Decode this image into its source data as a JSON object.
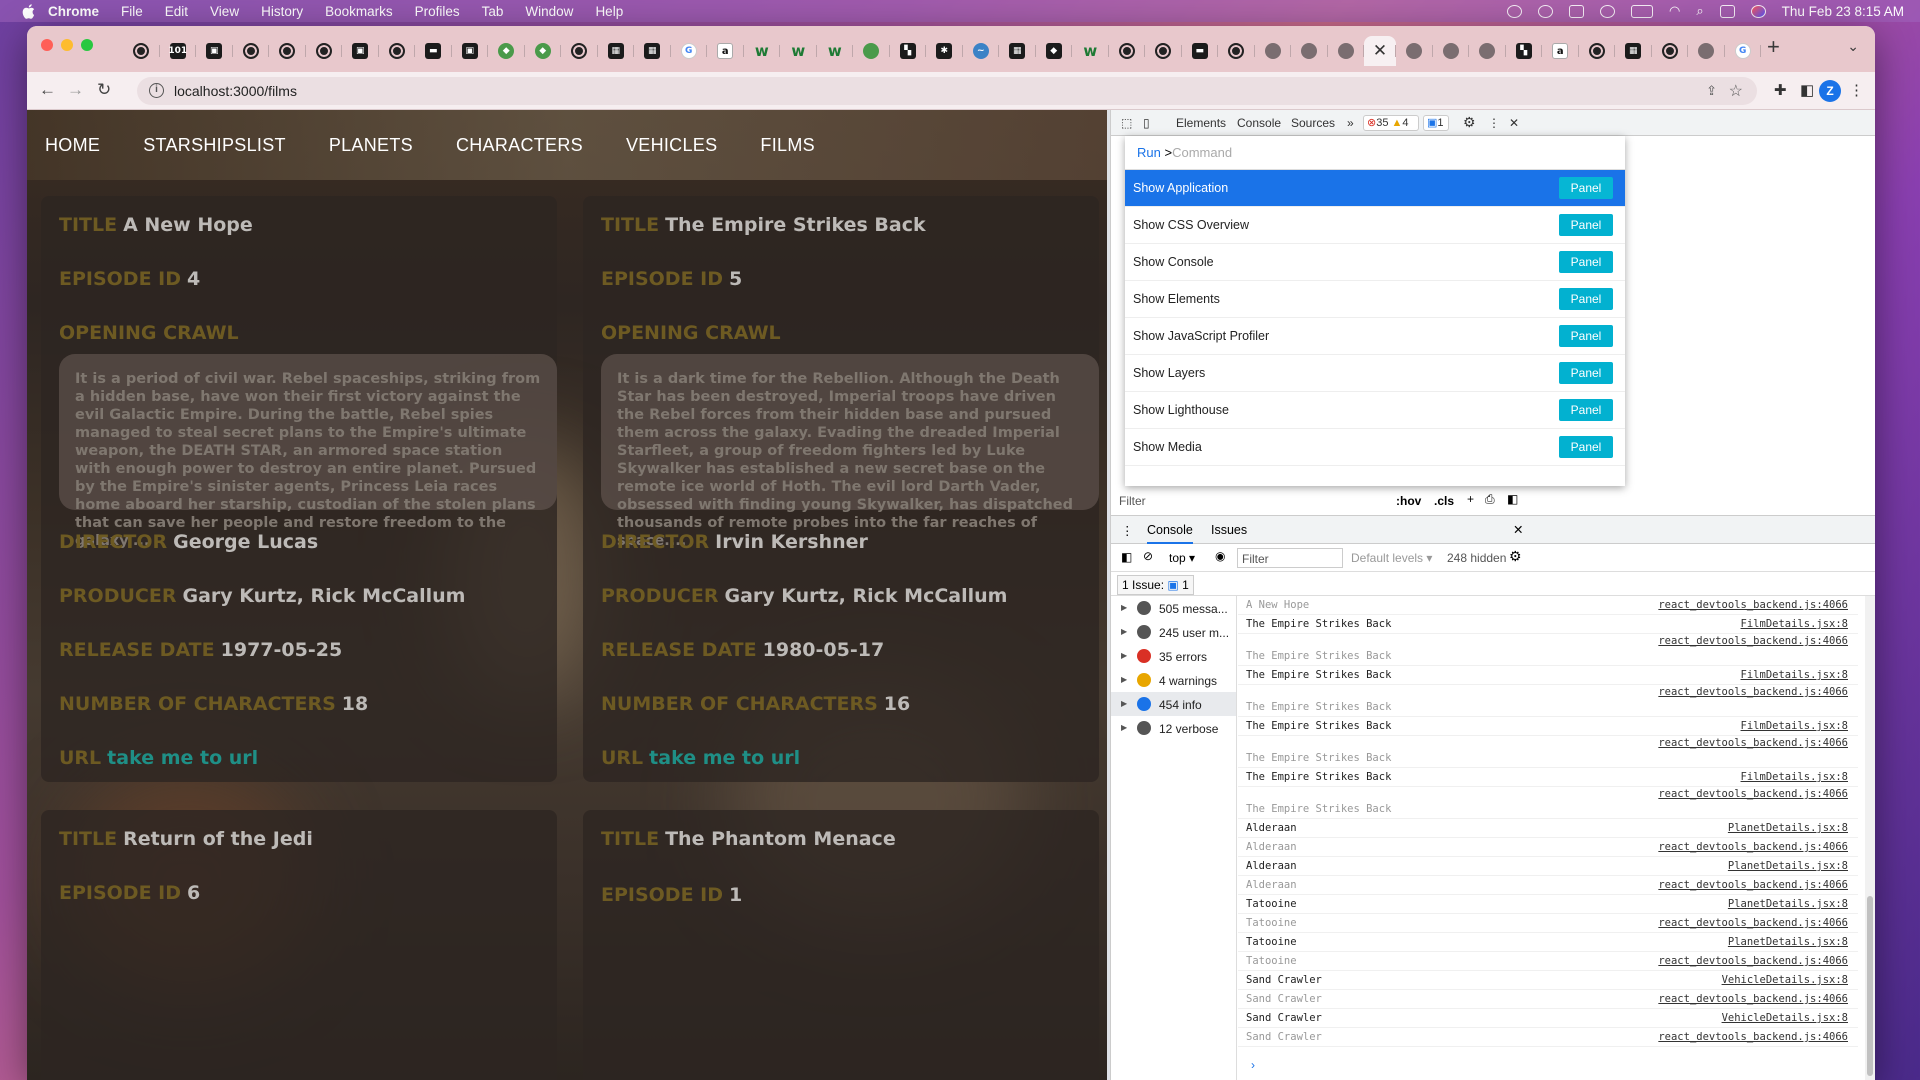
{
  "menubar": {
    "app": "Chrome",
    "items": [
      "File",
      "Edit",
      "View",
      "History",
      "Bookmarks",
      "Profiles",
      "Tab",
      "Window",
      "Help"
    ],
    "clock": "Thu Feb 23  8:15 AM"
  },
  "browser": {
    "url": "localhost:3000/films",
    "profile_initial": "Z",
    "tabs": [
      {
        "icon": "gh"
      },
      {
        "icon": "sq",
        "t": "101"
      },
      {
        "icon": "sq",
        "t": "▣"
      },
      {
        "icon": "gh"
      },
      {
        "icon": "gh"
      },
      {
        "icon": "gh"
      },
      {
        "icon": "sq",
        "t": "▣"
      },
      {
        "icon": "gh"
      },
      {
        "icon": "sq",
        "t": "▬"
      },
      {
        "icon": "sq",
        "t": "▣"
      },
      {
        "icon": "grn",
        "t": "◆"
      },
      {
        "icon": "grn",
        "t": "◆"
      },
      {
        "icon": "gh"
      },
      {
        "icon": "sq",
        "t": "▦"
      },
      {
        "icon": "sq",
        "t": "▦"
      },
      {
        "icon": "g",
        "t": "G"
      },
      {
        "icon": "a",
        "t": "a"
      },
      {
        "icon": "w",
        "t": "w"
      },
      {
        "icon": "w",
        "t": "w"
      },
      {
        "icon": "w",
        "t": "w"
      },
      {
        "icon": "grn",
        "t": ""
      },
      {
        "icon": "sq",
        "t": "▚"
      },
      {
        "icon": "sq",
        "t": "✱"
      },
      {
        "icon": "blu",
        "t": "~"
      },
      {
        "icon": "sq",
        "t": "▦"
      },
      {
        "icon": "sq",
        "t": "◆"
      },
      {
        "icon": "w",
        "t": "w"
      },
      {
        "icon": "gh"
      },
      {
        "icon": "gh"
      },
      {
        "icon": "sq",
        "t": "▬"
      },
      {
        "icon": "gh"
      },
      {
        "icon": "gry",
        "t": ""
      },
      {
        "icon": "gry",
        "t": ""
      },
      {
        "icon": "gry",
        "t": ""
      },
      {
        "icon": "active"
      },
      {
        "icon": "gry",
        "t": ""
      },
      {
        "icon": "gry",
        "t": ""
      },
      {
        "icon": "gry",
        "t": ""
      },
      {
        "icon": "sq",
        "t": "▚"
      },
      {
        "icon": "a",
        "t": "a"
      },
      {
        "icon": "gh"
      },
      {
        "icon": "sq",
        "t": "▦"
      },
      {
        "icon": "gh"
      },
      {
        "icon": "gry",
        "t": ""
      },
      {
        "icon": "g",
        "t": "G"
      }
    ]
  },
  "site": {
    "nav": [
      "HOME",
      "STARSHIPSLIST",
      "PLANETS",
      "CHARACTERS",
      "VEHICLES",
      "FILMS"
    ],
    "labels": {
      "title": "TITLE",
      "episode": "EPISODE ID",
      "crawl": "OPENING CRAWL",
      "director": "DIRECTOR",
      "producer": "PRODUCER",
      "release": "RELEASE DATE",
      "characters": "NUMBER OF CHARACTERS",
      "url": "URL"
    },
    "link_text": "take me to url",
    "films": [
      {
        "title": "A New Hope",
        "episode": "4",
        "crawl": "It is a period of civil war. Rebel spaceships, striking from a hidden base, have won their first victory against the evil Galactic Empire. During the battle, Rebel spies managed to steal secret plans to the Empire's ultimate weapon, the DEATH STAR, an armored space station with enough power to destroy an entire planet. Pursued by the Empire's sinister agents, Princess Leia races home aboard her starship, custodian of the stolen plans that can save her people and restore freedom to the galaxy....",
        "director": "George Lucas",
        "producer": "Gary Kurtz, Rick McCallum",
        "release": "1977-05-25",
        "characters": "18"
      },
      {
        "title": "The Empire Strikes Back",
        "episode": "5",
        "crawl": "It is a dark time for the Rebellion. Although the Death Star has been destroyed, Imperial troops have driven the Rebel forces from their hidden base and pursued them across the galaxy. Evading the dreaded Imperial Starfleet, a group of freedom fighters led by Luke Skywalker has established a new secret base on the remote ice world of Hoth. The evil lord Darth Vader, obsessed with finding young Skywalker, has dispatched thousands of remote probes into the far reaches of space....",
        "director": "Irvin Kershner",
        "producer": "Gary Kurtz, Rick McCallum",
        "release": "1980-05-17",
        "characters": "16"
      },
      {
        "title": "Return of the Jedi",
        "episode": "6"
      },
      {
        "title": "The Phantom Menace",
        "episode": "1"
      }
    ]
  },
  "devtools": {
    "tabs": [
      "Elements",
      "Console",
      "Sources"
    ],
    "error_count": "35",
    "warning_count": "4",
    "issue_count": "1",
    "command": {
      "run": "Run",
      "prompt": ">",
      "placeholder": "Command"
    },
    "commands": [
      "Show Application",
      "Show CSS Overview",
      "Show Console",
      "Show Elements",
      "Show JavaScript Profiler",
      "Show Layers",
      "Show Lighthouse",
      "Show Media"
    ],
    "panel_label": "Panel",
    "styles_filter": "Filter",
    "hov": ":hov",
    "cls": ".cls",
    "drawer_tabs": [
      "Console",
      "Issues"
    ],
    "context": "top",
    "console_filter": "Filter",
    "levels": "Default levels",
    "hidden": "248 hidden",
    "issues_label": "1 Issue:",
    "issues_num": "1",
    "sidebar": [
      {
        "label": "505 messa...",
        "icon": "list-icon",
        "color": "#555"
      },
      {
        "label": "245 user m...",
        "icon": "user-icon",
        "color": "#555"
      },
      {
        "label": "35 errors",
        "icon": "error-icon",
        "color": "#d93025"
      },
      {
        "label": "4 warnings",
        "icon": "warning-icon",
        "color": "#e8a600"
      },
      {
        "label": "454 info",
        "icon": "info-icon",
        "color": "#1a73e8"
      },
      {
        "label": "12 verbose",
        "icon": "bug-icon",
        "color": "#555"
      }
    ],
    "logs": [
      {
        "text": "A New Hope",
        "src": "react_devtools_backend.js:4066",
        "dim": true,
        "kind": "plain"
      },
      {
        "text": "The Empire Strikes Back",
        "src": "FilmDetails.jsx:8",
        "dim": false,
        "kind": "plain"
      },
      {
        "text": "The Empire Strikes Back",
        "src": "react_devtools_backend.js:4066",
        "dim": true,
        "kind": "two"
      },
      {
        "text": "The Empire Strikes Back",
        "src": "FilmDetails.jsx:8",
        "dim": false,
        "kind": "plain"
      },
      {
        "text": "The Empire Strikes Back",
        "src": "react_devtools_backend.js:4066",
        "dim": true,
        "kind": "two"
      },
      {
        "text": "The Empire Strikes Back",
        "src": "FilmDetails.jsx:8",
        "dim": false,
        "kind": "plain"
      },
      {
        "text": "The Empire Strikes Back",
        "src": "react_devtools_backend.js:4066",
        "dim": true,
        "kind": "two"
      },
      {
        "text": "The Empire Strikes Back",
        "src": "FilmDetails.jsx:8",
        "dim": false,
        "kind": "plain"
      },
      {
        "text": "The Empire Strikes Back",
        "src": "react_devtools_backend.js:4066",
        "dim": true,
        "kind": "two"
      },
      {
        "text": "Alderaan",
        "src": "PlanetDetails.jsx:8",
        "dim": false,
        "kind": "plain"
      },
      {
        "text": "Alderaan",
        "src": "react_devtools_backend.js:4066",
        "dim": true,
        "kind": "plain"
      },
      {
        "text": "Alderaan",
        "src": "PlanetDetails.jsx:8",
        "dim": false,
        "kind": "plain"
      },
      {
        "text": "Alderaan",
        "src": "react_devtools_backend.js:4066",
        "dim": true,
        "kind": "plain"
      },
      {
        "text": "Tatooine",
        "src": "PlanetDetails.jsx:8",
        "dim": false,
        "kind": "plain"
      },
      {
        "text": "Tatooine",
        "src": "react_devtools_backend.js:4066",
        "dim": true,
        "kind": "plain"
      },
      {
        "text": "Tatooine",
        "src": "PlanetDetails.jsx:8",
        "dim": false,
        "kind": "plain"
      },
      {
        "text": "Tatooine",
        "src": "react_devtools_backend.js:4066",
        "dim": true,
        "kind": "plain"
      },
      {
        "text": "Sand Crawler",
        "src": "VehicleDetails.jsx:8",
        "dim": false,
        "kind": "plain"
      },
      {
        "text": "Sand Crawler",
        "src": "react_devtools_backend.js:4066",
        "dim": true,
        "kind": "plain"
      },
      {
        "text": "Sand Crawler",
        "src": "VehicleDetails.jsx:8",
        "dim": false,
        "kind": "plain"
      },
      {
        "text": "Sand Crawler",
        "src": "react_devtools_backend.js:4066",
        "dim": true,
        "kind": "plain"
      }
    ]
  }
}
